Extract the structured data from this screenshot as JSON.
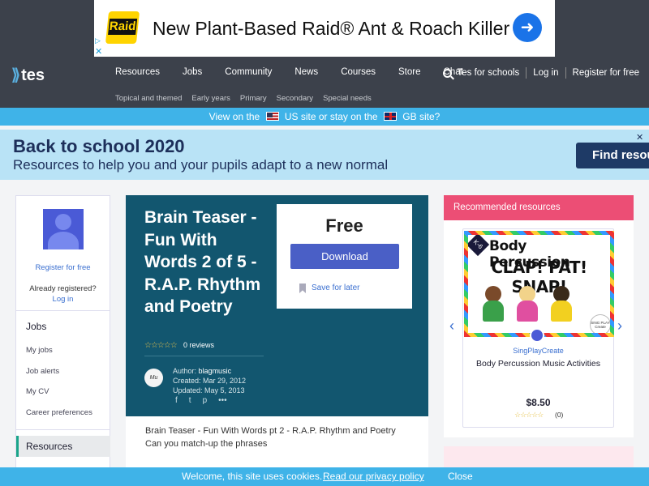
{
  "ad": {
    "brand": "Raid",
    "headline": "New Plant-Based Raid® Ant & Roach Killer",
    "arrow": "➜",
    "ad_icon": "▷",
    "close": "✕"
  },
  "nav": {
    "brand": "tes",
    "items": [
      "Resources",
      "Jobs",
      "Community",
      "News",
      "Courses",
      "Store",
      "Chat"
    ],
    "tes_for_schools": "Tes for schools",
    "login": "Log in",
    "register": "Register for free",
    "subitems": [
      "Topical and themed",
      "Early years",
      "Primary",
      "Secondary",
      "Special needs"
    ]
  },
  "locbar": {
    "view_on": "View on the",
    "us_site": "US site or stay on the",
    "gb_site": "GB site?"
  },
  "banner": {
    "title": "Back to school 2020",
    "subtitle": "Resources to help you and your pupils adapt to a new normal",
    "button": "Find resou",
    "close": "✕"
  },
  "sidebar": {
    "register": "Register for free",
    "already": "Already registered?",
    "login": "Log in",
    "jobs_heading": "Jobs",
    "jobs_items": [
      "My jobs",
      "Job alerts",
      "My CV",
      "Career preferences"
    ],
    "resources": "Resources"
  },
  "resource": {
    "title": "Brain Teaser - Fun With Words 2 of 5 - R.A.P. Rhythm and Poetry",
    "stars": "☆☆☆☆☆",
    "reviews": "0 reviews",
    "author_avatar": "Mu",
    "author_label": "Author:",
    "author_name": "blagmusic",
    "created": "Created: Mar 29, 2012",
    "updated": "Updated: May 5, 2013",
    "share": [
      "f",
      "t",
      "p",
      "•••"
    ],
    "price": "Free",
    "download": "Download",
    "save": "Save for later",
    "description": "Brain Teaser - Fun With Words pt 2 - R.A.P. Rhythm and Poetry Can you match-up the phrases"
  },
  "recommended": {
    "heading": "Recommended resources",
    "thumb_k6": "K-6",
    "thumb_title1": "Body Percussion",
    "thumb_title2": "CLAP! PAT! SNAP!",
    "thumb_badge": "SING PLAY Create",
    "provider": "SingPlayCreate",
    "name": "Body Percussion Music Activities",
    "price": "$8.50",
    "stars": "☆☆☆☆☆",
    "count": "(0)",
    "prev": "‹",
    "next": "›"
  },
  "cookie": {
    "message": "Welcome, this site uses cookies.",
    "policy": "Read our privacy policy",
    "close": "Close"
  },
  "colors": {
    "nav_bg": "#3c414b",
    "hero_bg": "#12566f",
    "download_btn": "#4a5fc6",
    "rec_head": "#ec4e75",
    "info_bar": "#3fb3e8"
  }
}
